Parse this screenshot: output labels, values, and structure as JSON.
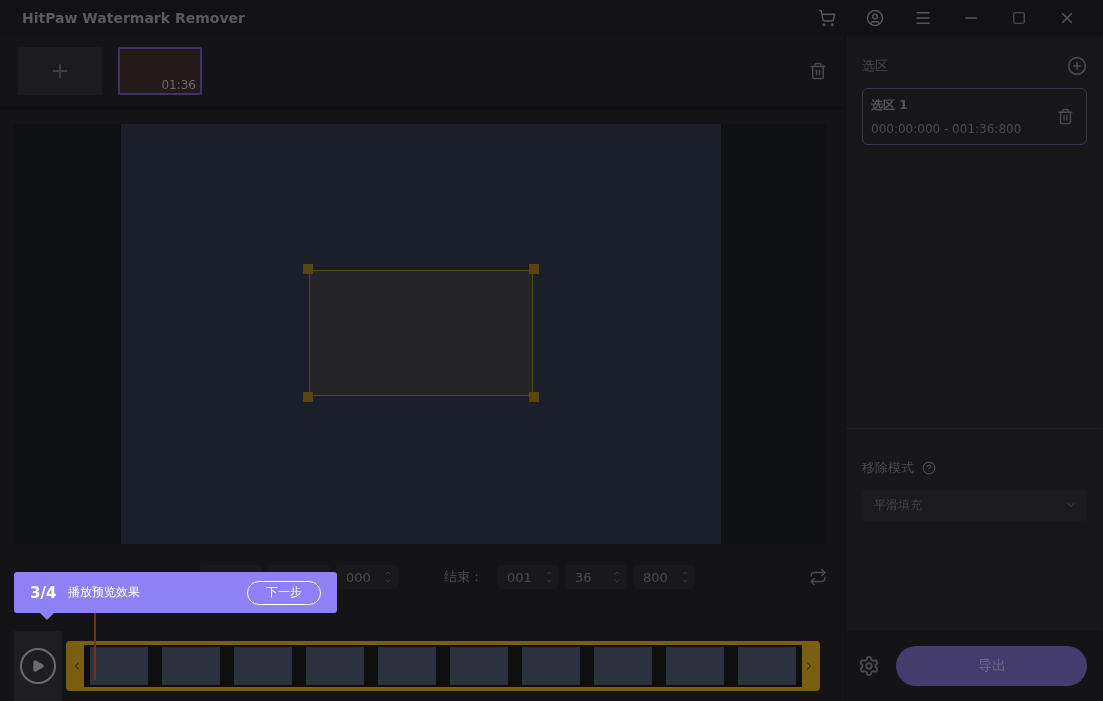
{
  "window": {
    "title": "HitPaw Watermark Remover"
  },
  "media": {
    "items": [
      {
        "duration": "01:36",
        "selected": true
      }
    ]
  },
  "time": {
    "start": [
      "000"
    ],
    "end_label": "结束：",
    "end": [
      "001",
      "36",
      "800"
    ]
  },
  "guide": {
    "step": "3/4",
    "text": "播放预览效果",
    "next": "下一步"
  },
  "selections": {
    "title": "选区",
    "items": [
      {
        "name": "选区 1",
        "range": "000:00:000 - 001:36:800",
        "selected": true
      }
    ]
  },
  "mode": {
    "label": "移除模式",
    "value": "平滑填充"
  },
  "export": {
    "label": "导出"
  }
}
